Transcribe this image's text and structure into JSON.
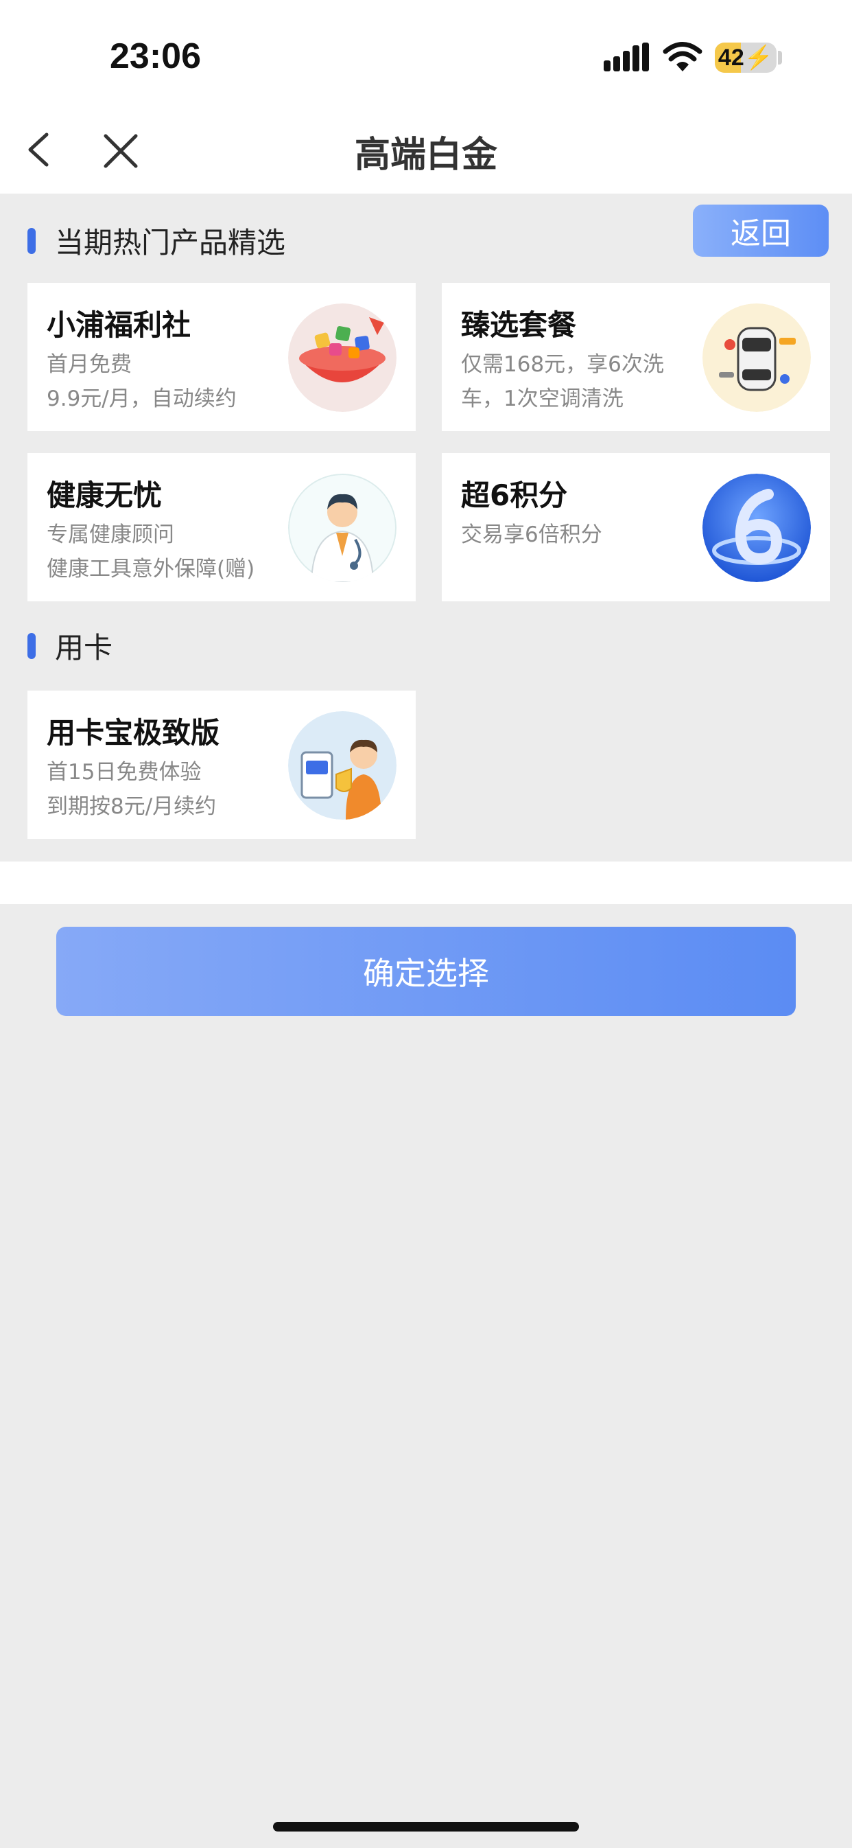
{
  "status_bar": {
    "time": "23:06",
    "battery_level": "42",
    "battery_fraction": 0.42,
    "icons": [
      "signal-icon",
      "wifi-icon",
      "battery-icon"
    ]
  },
  "nav": {
    "title": "高端白金",
    "icons": [
      "back-chevron-icon",
      "close-icon"
    ]
  },
  "return_label": "返回",
  "sections": [
    {
      "title": "当期热门产品精选",
      "cards": [
        {
          "title": "小浦福利社",
          "lines": [
            "首月免费",
            "9.9元/月，自动续约"
          ],
          "image": "gift-bowl-image"
        },
        {
          "title": "臻选套餐",
          "lines": [
            "仅需168元，享6次洗",
            "车，1次空调清洗"
          ],
          "image": "car-service-image"
        },
        {
          "title": "健康无忧",
          "lines": [
            "专属健康顾问",
            "健康工具意外保障(赠)"
          ],
          "image": "doctor-image"
        },
        {
          "title": "超6积分",
          "lines": [
            "交易享6倍积分"
          ],
          "image": "number-six-image"
        }
      ]
    },
    {
      "title": "用卡",
      "cards": [
        {
          "title": "用卡宝极致版",
          "lines": [
            "首15日免费体验",
            "到期按8元/月续约"
          ],
          "image": "card-protection-image"
        }
      ]
    }
  ],
  "confirm_label": "确定选择",
  "colors": {
    "accent": "#3d6ee6",
    "button_gradient_start": "#86a9f7",
    "button_gradient_end": "#5b8cf3",
    "background": "#ececec"
  }
}
